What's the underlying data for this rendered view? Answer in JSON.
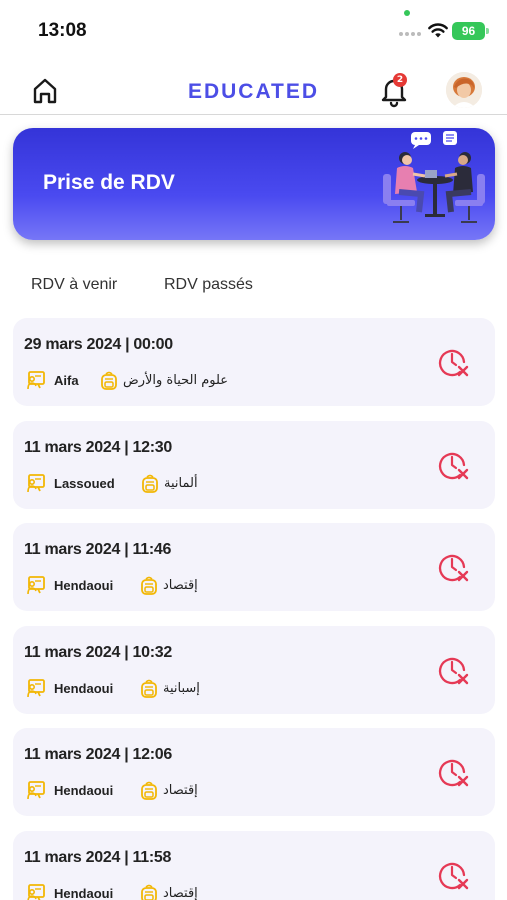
{
  "status_bar": {
    "time": "13:08",
    "battery": "96"
  },
  "header": {
    "logo": "EDUCATED",
    "notification_count": "2"
  },
  "banner": {
    "title": "Prise de RDV"
  },
  "tabs": [
    {
      "label": "RDV à venir"
    },
    {
      "label": "RDV passés"
    }
  ],
  "appointments": [
    {
      "date": "29 mars 2024 | 00:00",
      "teacher": "Aifa",
      "subject": "علوم الحياة والأرض"
    },
    {
      "date": "11 mars 2024 | 12:30",
      "teacher": "Lassoued",
      "subject": "ألمانية"
    },
    {
      "date": "11 mars 2024 | 11:46",
      "teacher": "Hendaoui",
      "subject": "إقتصاد"
    },
    {
      "date": "11 mars 2024 | 10:32",
      "teacher": "Hendaoui",
      "subject": "إسبانية"
    },
    {
      "date": "11 mars 2024 | 12:06",
      "teacher": "Hendaoui",
      "subject": "إقتصاد"
    },
    {
      "date": "11 mars 2024 | 11:58",
      "teacher": "Hendaoui",
      "subject": "إقتصاد"
    }
  ],
  "colors": {
    "brand": "#4c4ee6",
    "banner": "#3a3ae0",
    "card": "#f4f3fb",
    "icon_orange": "#f2b705",
    "cancel_red": "#e53955"
  },
  "icons": {
    "home": "home-icon",
    "bell": "bell-icon",
    "teacher": "teacher-board-icon",
    "subject": "backpack-icon",
    "cancel": "cancel-appointment-icon"
  }
}
